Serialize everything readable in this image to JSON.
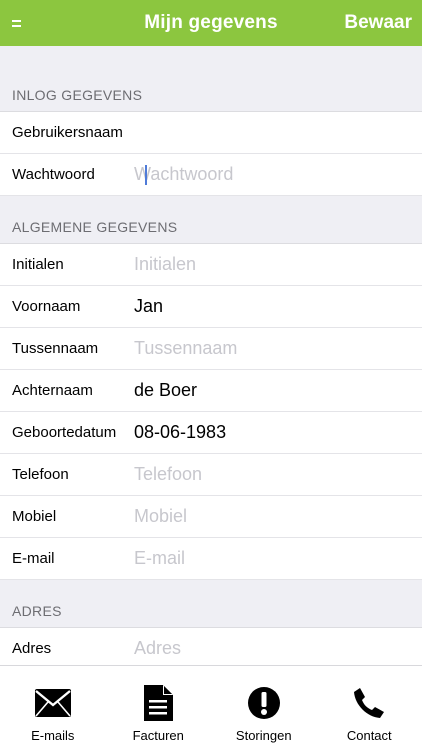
{
  "header": {
    "menu_icon": "menu-icon",
    "title": "Mijn gegevens",
    "save_label": "Bewaar"
  },
  "colors": {
    "accent": "#8cc63f",
    "background": "#efeff4",
    "placeholder": "#c7c7cd",
    "caret": "#4f7bd8"
  },
  "sections": {
    "login": {
      "title": "INLOG GEGEVENS",
      "username": {
        "label": "Gebruikersnaam",
        "value": "",
        "placeholder": ""
      },
      "password": {
        "label": "Wachtwoord",
        "value": "",
        "placeholder": "Wachtwoord"
      }
    },
    "general": {
      "title": "ALGEMENE GEGEVENS",
      "initials": {
        "label": "Initialen",
        "value": "",
        "placeholder": "Initialen"
      },
      "firstname": {
        "label": "Voornaam",
        "value": "Jan",
        "placeholder": ""
      },
      "infix": {
        "label": "Tussennaam",
        "value": "",
        "placeholder": "Tussennaam"
      },
      "lastname": {
        "label": "Achternaam",
        "value": "de Boer",
        "placeholder": ""
      },
      "birthdate": {
        "label": "Geboortedatum",
        "value": "08-06-1983",
        "placeholder": ""
      },
      "phone": {
        "label": "Telefoon",
        "value": "",
        "placeholder": "Telefoon"
      },
      "mobile": {
        "label": "Mobiel",
        "value": "",
        "placeholder": "Mobiel"
      },
      "email": {
        "label": "E-mail",
        "value": "",
        "placeholder": "E-mail"
      }
    },
    "address": {
      "title": "ADRES",
      "address": {
        "label": "Adres",
        "value": "",
        "placeholder": "Adres"
      }
    }
  },
  "tabbar": {
    "emails": {
      "label": "E-mails",
      "icon": "envelope-icon"
    },
    "invoices": {
      "label": "Facturen",
      "icon": "document-icon"
    },
    "outages": {
      "label": "Storingen",
      "icon": "alert-icon"
    },
    "contact": {
      "label": "Contact",
      "icon": "phone-icon"
    }
  }
}
